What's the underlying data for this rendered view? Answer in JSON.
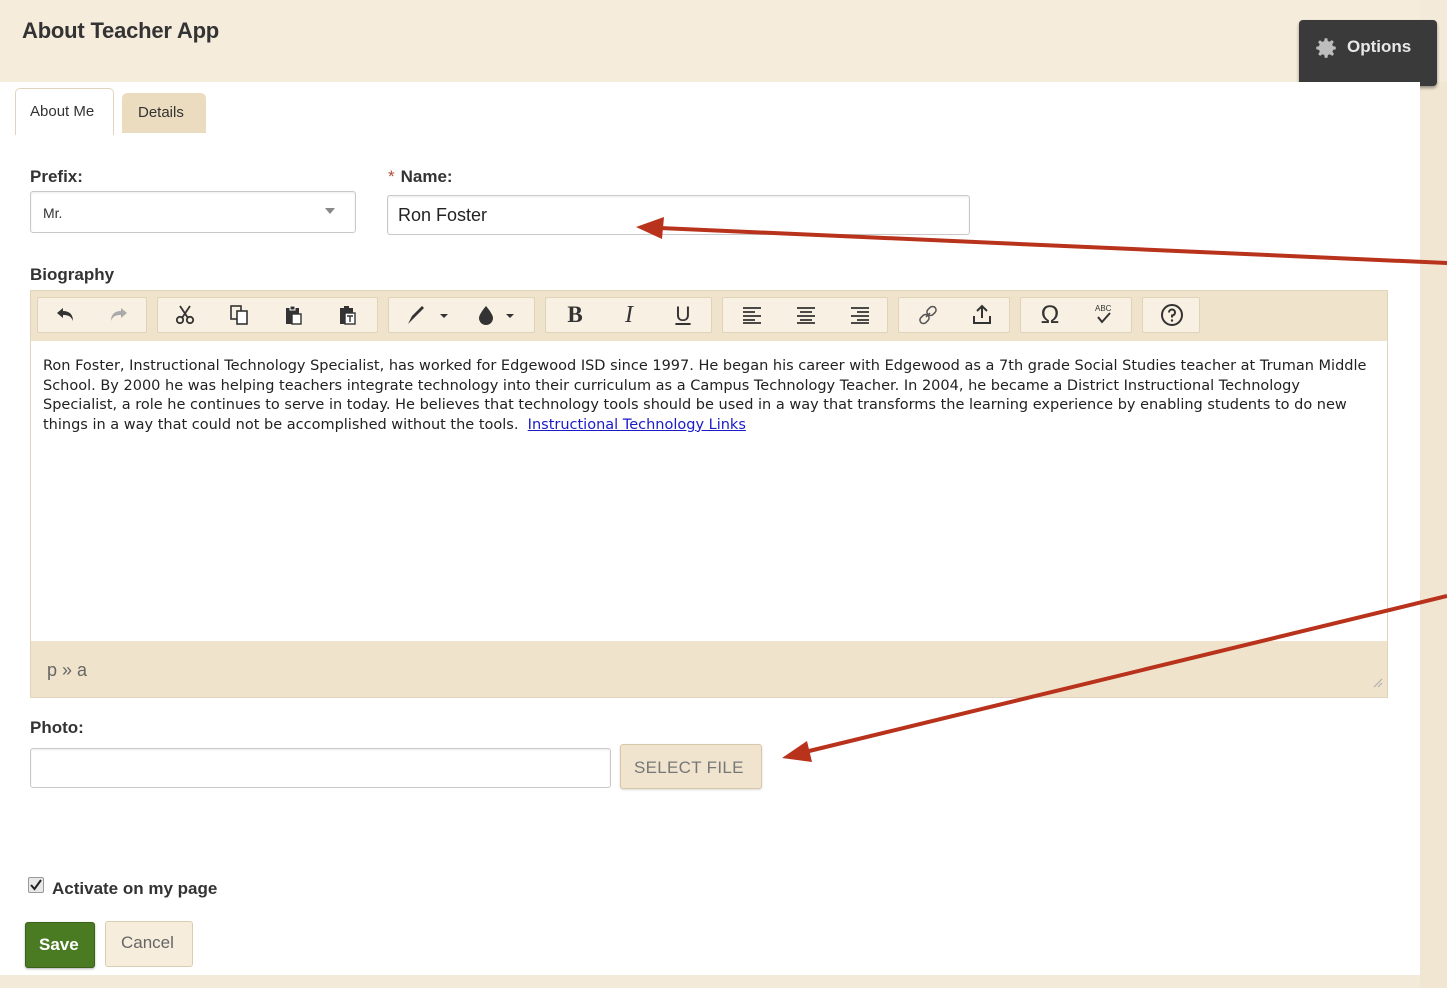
{
  "header": {
    "title": "About Teacher App",
    "options_label": "Options"
  },
  "tabs": [
    {
      "label": "About Me",
      "active": true
    },
    {
      "label": "Details",
      "active": false
    }
  ],
  "form": {
    "prefix_label": "Prefix:",
    "prefix_value": "Mr.",
    "name_required_mark": "*",
    "name_label": "Name:",
    "name_value": "Ron Foster",
    "biography_label": "Biography",
    "biography_text": "Ron Foster, Instructional Technology Specialist, has worked for Edgewood ISD since 1997.  He began his career with Edgewood as a 7th grade Social Studies teacher at Truman Middle School. By 2000 he was helping teachers integrate technology into their curriculum as a Campus Technology Teacher. In 2004, he became a District Instructional Technology Specialist, a role he continues to serve in today.  He believes that technology tools should be used in a way that transforms the learning experience by enabling students to do new things in a way that could not be accomplished without the tools.",
    "biography_link": "Instructional Technology Links",
    "editor_path": "p » a",
    "photo_label": "Photo:",
    "photo_value": "",
    "select_file_label": "SELECT FILE",
    "activate_label": "Activate on my page",
    "activate_checked": true,
    "save_label": "Save",
    "cancel_label": "Cancel"
  },
  "toolbar": {
    "icons": [
      "undo-icon",
      "redo-icon",
      "cut-icon",
      "copy-icon",
      "paste-icon",
      "paste-text-icon",
      "text-color-icon",
      "background-color-icon",
      "bold-icon",
      "italic-icon",
      "underline-icon",
      "align-left-icon",
      "align-center-icon",
      "align-right-icon",
      "link-icon",
      "upload-icon",
      "special-character-icon",
      "spellcheck-icon",
      "help-icon"
    ],
    "bold_glyph": "B",
    "italic_glyph": "I",
    "underline_glyph": "U",
    "omega_glyph": "Ω",
    "abc_glyph": "ABC"
  },
  "colors": {
    "accent": "#4a7a22",
    "chrome": "#efe3cc",
    "annotation_arrow": "#b8321c"
  }
}
